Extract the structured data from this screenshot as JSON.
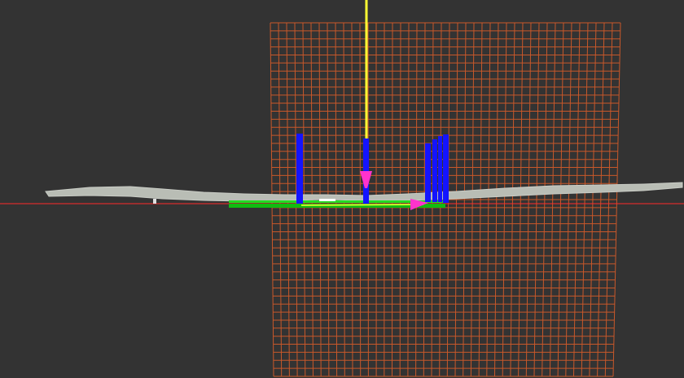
{
  "app": {
    "view": "3d-visualization-viewport"
  },
  "colors": {
    "background": "#333333",
    "grid": "#c8582a",
    "axis_line": "#ff2a2a",
    "point_cloud": "#b9bdb5",
    "pillar": "#1414ff",
    "path_line": "#ffff33",
    "trajectory": "#22dd22",
    "pose_marker": "#ff33cc"
  },
  "icons": {
    "goal_pose": "goal-marker-icon",
    "robot_pose": "robot-pose-icon"
  }
}
